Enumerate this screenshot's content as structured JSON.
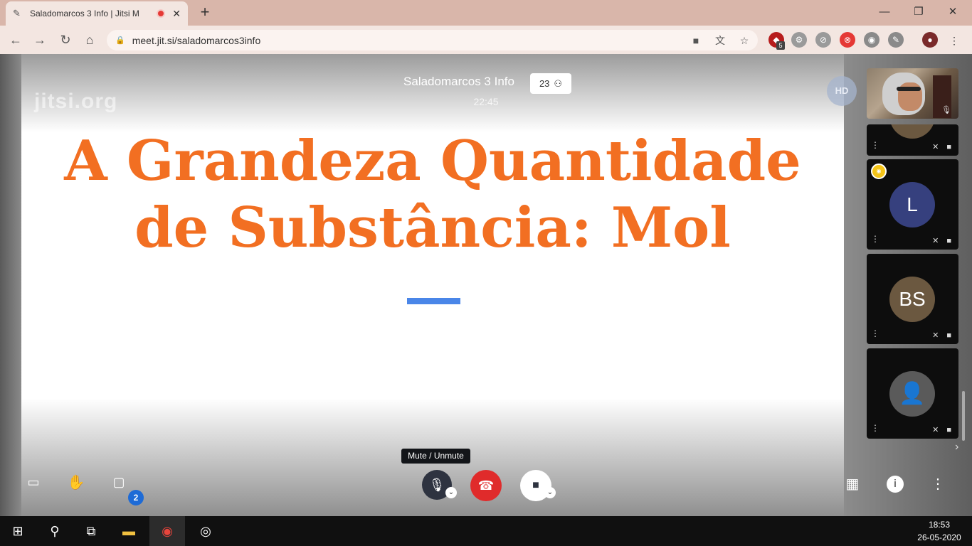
{
  "browser": {
    "tab_title": "Saladomarcos 3 Info | Jitsi M",
    "url": "meet.jit.si/saladomarcos3info",
    "extension_badge": "5"
  },
  "meeting": {
    "conference_name": "Saladomarcos 3 Info",
    "participant_count": "23",
    "elapsed_time": "22:45",
    "quality_badge": "HD",
    "watermark": "jitsi.org"
  },
  "slide": {
    "title_line1": "A Grandeza Quantidade",
    "title_line2": "de Substância: Mol"
  },
  "filmstrip": {
    "participants": [
      {
        "initials": "L",
        "color": "#36407e"
      },
      {
        "initials": "BS",
        "color": "#6b5840"
      },
      {
        "initials": "",
        "color": "#5a5a5a"
      }
    ]
  },
  "toolbox": {
    "mute_tooltip": "Mute / Unmute",
    "chat_unread": "2"
  },
  "taskbar": {
    "time": "18:53",
    "date": "26-05-2020"
  }
}
